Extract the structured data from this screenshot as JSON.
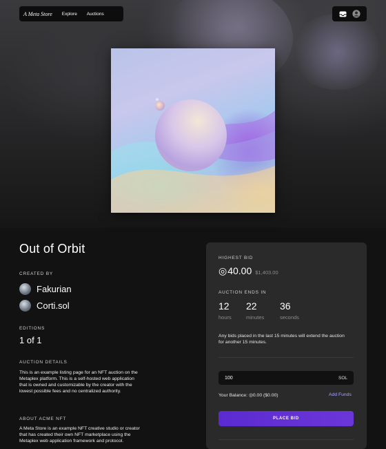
{
  "nav": {
    "brand": "A Meta Store",
    "links": [
      "Explore",
      "Auctions"
    ],
    "icons": [
      "inbox-icon",
      "user-avatar-icon"
    ]
  },
  "artwork": {
    "alt": "Out of Orbit artwork"
  },
  "listing": {
    "title": "Out of Orbit",
    "created_by_label": "CREATED BY",
    "creators": [
      {
        "name": "Fakurian"
      },
      {
        "name": "Corti.sol"
      }
    ],
    "editions_label": "EDITIONS",
    "editions_value": "1 of 1",
    "auction_details_label": "AUCTION DETAILS",
    "auction_details_text": "This is an example listing page for an NFT auction on the Metaplex platform. This is a self-hosted web application that is owned and customizable by the creator with the lowest possible fees and no centralized authority.",
    "about_label": "ABOUT ACME NFT",
    "about_text": "A Meta Store is an example NFT creative studio or creator that has created their own NFT marketplace using the Metaplex web application framework and protocol."
  },
  "bid_card": {
    "highest_bid_label": "HIGHEST BID",
    "currency_symbol": "◎",
    "highest_bid_value": "40.00",
    "highest_bid_usd": "$1,403.00",
    "auction_ends_label": "AUCTION ENDS IN",
    "countdown": [
      {
        "value": "12",
        "unit": "hours"
      },
      {
        "value": "22",
        "unit": "minutes"
      },
      {
        "value": "36",
        "unit": "seconds"
      }
    ],
    "notice": "Any bids placed in the last 15 minutes will extend the auction for another 15 minutes.",
    "bid_input_value": "100",
    "bid_input_suffix": "SOL",
    "balance": "Your Balance: ◎0.00 ($0.00)",
    "add_funds": "Add Funds",
    "place_bid": "PLACE BID"
  },
  "colors": {
    "background": "#121212",
    "card": "#2a2a2a",
    "accent": "#5b2bd1",
    "link": "#a9a4ff"
  }
}
